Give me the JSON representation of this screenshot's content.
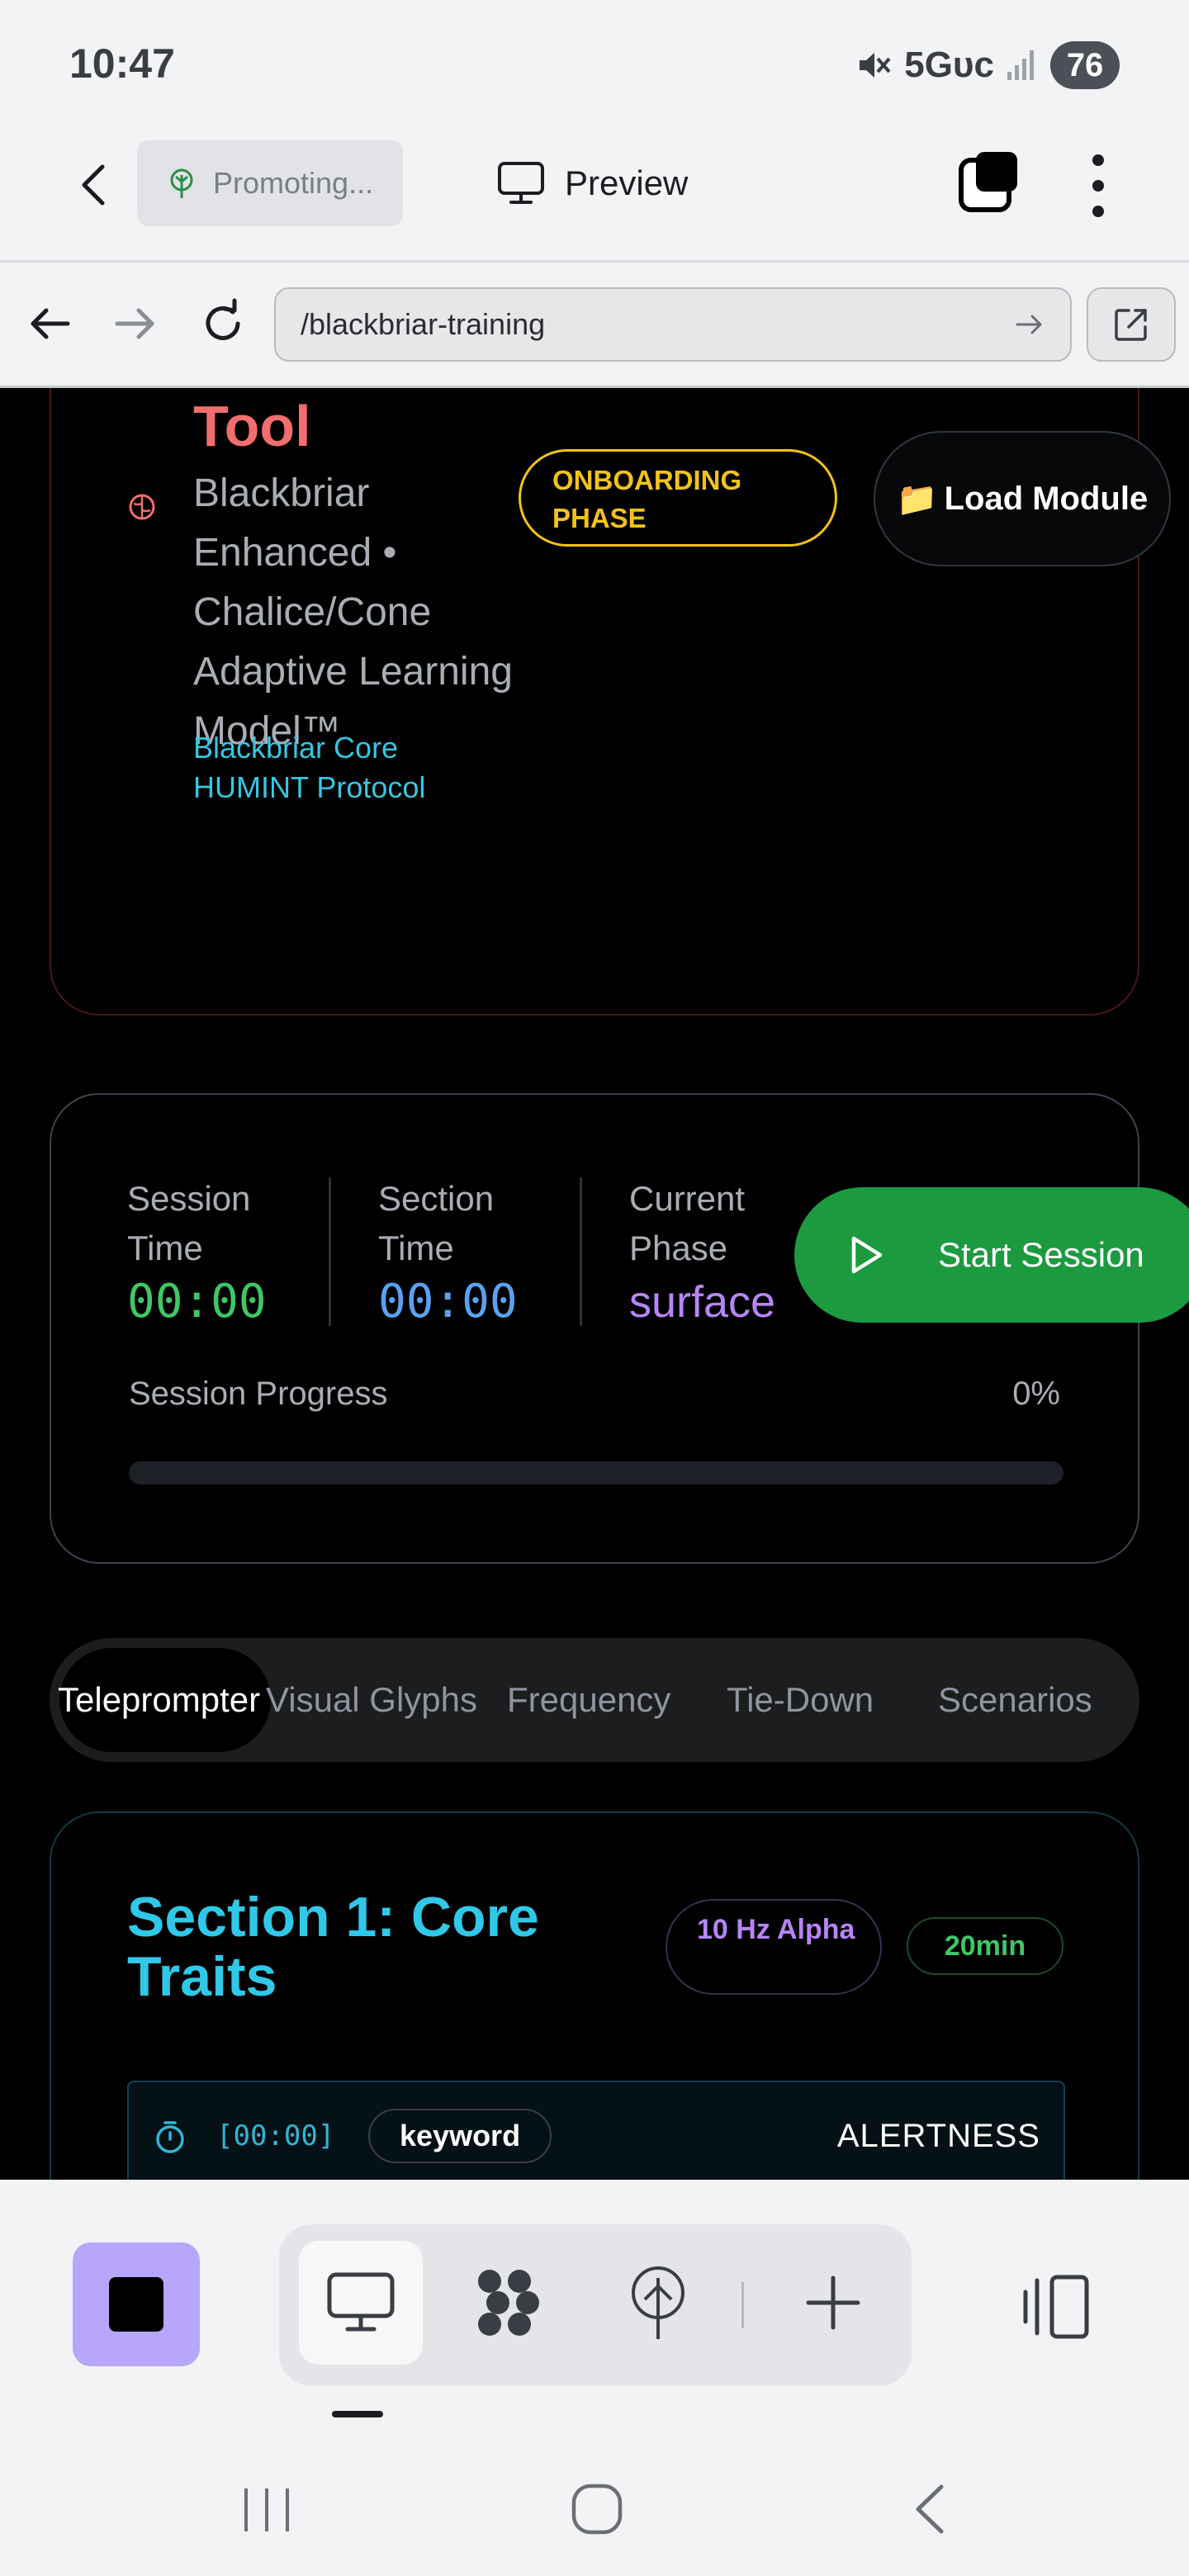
{
  "status_bar": {
    "time": "10:47",
    "network": "5Gᴜᴄ",
    "battery": "76"
  },
  "header": {
    "promo_label": "Promoting...",
    "preview_label": "Preview"
  },
  "url_bar": {
    "url": "/blackbriar-training"
  },
  "hero": {
    "title": "Training Tool",
    "subtitle": "Blackbriar Enhanced • Chalice/Cone Adaptive Learning Model™",
    "protocol": "Blackbriar Core HUMINT Protocol",
    "phase_badge": "ONBOARDING PHASE",
    "load_button": "Load Module",
    "load_icon": "folder-icon"
  },
  "session": {
    "session_time_label": "Session Time",
    "session_time": "00:00",
    "section_time_label": "Section Time",
    "section_time": "00:00",
    "phase_label": "Current Phase",
    "phase_value": "surface",
    "start_button": "Start Session",
    "progress_label": "Session Progress",
    "progress_text": "0%",
    "progress_fraction": 0
  },
  "tabs": [
    {
      "label": "Teleprompter",
      "active": true
    },
    {
      "label": "Visual Glyphs",
      "active": false
    },
    {
      "label": "Frequency",
      "active": false
    },
    {
      "label": "Tie-Down",
      "active": false
    },
    {
      "label": "Scenarios",
      "active": false
    }
  ],
  "section": {
    "title": "Section 1: Core Traits",
    "frequency_badge": "10 Hz Alpha",
    "duration_badge": "20min",
    "cue": {
      "time": "[00:00]",
      "tag": "keyword",
      "word": "ALERTNESS"
    }
  },
  "colors": {
    "accent_red": "#f26d6d",
    "accent_cyan": "#2fc8e8",
    "accent_yellow": "#f2c21a",
    "accent_green": "#1c9a3f",
    "accent_purple": "#b685f5",
    "accent_blue": "#5aa2f0",
    "stop_button": "#b7a6fb"
  }
}
